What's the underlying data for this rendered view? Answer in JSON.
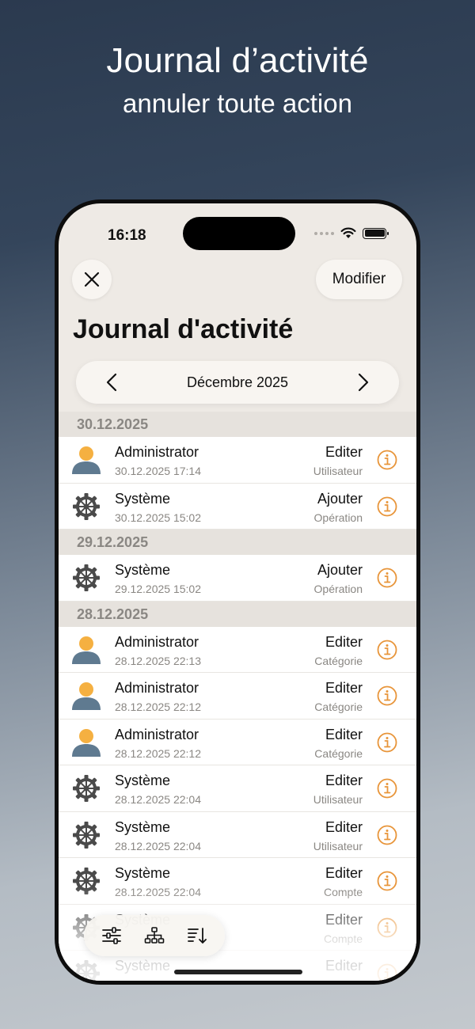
{
  "promo": {
    "title": "Journal d’activité",
    "subtitle": "annuler toute action"
  },
  "status_bar": {
    "time": "16:18"
  },
  "header": {
    "close_icon": "close-x-icon",
    "modify_label": "Modifier",
    "title": "Journal d'activité"
  },
  "month_nav": {
    "label": "Décembre 2025"
  },
  "sections": [
    {
      "date": "30.12.2025",
      "rows": [
        {
          "type": "user",
          "name": "Administrator",
          "date": "30.12.2025 17:14",
          "action": "Editer",
          "entity": "Utilisateur"
        },
        {
          "type": "system",
          "name": "Système",
          "date": "30.12.2025 15:02",
          "action": "Ajouter",
          "entity": "Opération"
        }
      ]
    },
    {
      "date": "29.12.2025",
      "rows": [
        {
          "type": "system",
          "name": "Système",
          "date": "29.12.2025 15:02",
          "action": "Ajouter",
          "entity": "Opération"
        }
      ]
    },
    {
      "date": "28.12.2025",
      "rows": [
        {
          "type": "user",
          "name": "Administrator",
          "date": "28.12.2025 22:13",
          "action": "Editer",
          "entity": "Catégorie"
        },
        {
          "type": "user",
          "name": "Administrator",
          "date": "28.12.2025 22:12",
          "action": "Editer",
          "entity": "Catégorie"
        },
        {
          "type": "user",
          "name": "Administrator",
          "date": "28.12.2025 22:12",
          "action": "Editer",
          "entity": "Catégorie"
        },
        {
          "type": "system",
          "name": "Système",
          "date": "28.12.2025 22:04",
          "action": "Editer",
          "entity": "Utilisateur"
        },
        {
          "type": "system",
          "name": "Système",
          "date": "28.12.2025 22:04",
          "action": "Editer",
          "entity": "Utilisateur"
        },
        {
          "type": "system",
          "name": "Système",
          "date": "28.12.2025 22:04",
          "action": "Editer",
          "entity": "Compte"
        },
        {
          "type": "system",
          "name": "Système",
          "date": "",
          "action": "Editer",
          "entity": "Compte"
        },
        {
          "type": "system",
          "name": "Système",
          "date": "",
          "action": "Editer",
          "entity": ""
        }
      ]
    }
  ],
  "toolbar": {
    "items": [
      "filter-sliders-icon",
      "hierarchy-icon",
      "sort-icon"
    ]
  },
  "colors": {
    "accent": "#e8953a",
    "avatar_head": "#f5b041",
    "avatar_body": "#5f7a90",
    "gear": "#4a4a4a",
    "background": "#eeeae5"
  }
}
